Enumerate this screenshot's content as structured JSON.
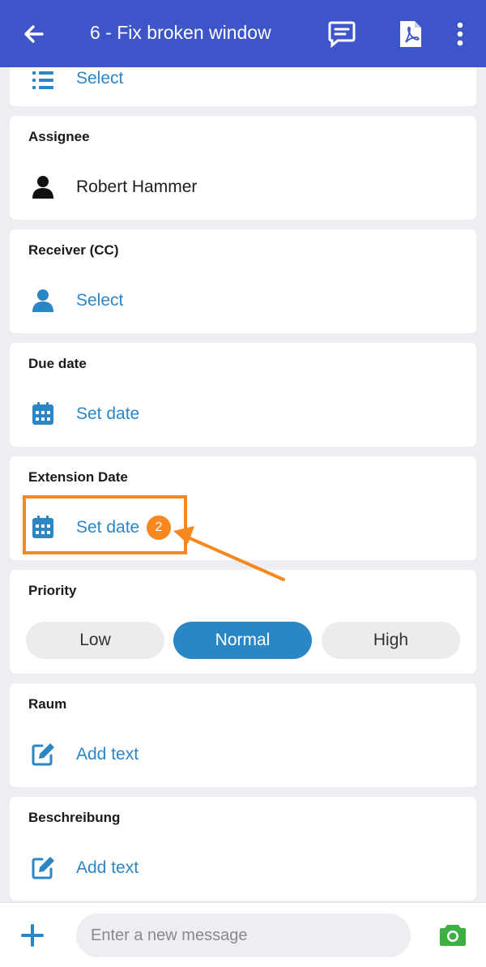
{
  "header": {
    "title": "6 - Fix broken window"
  },
  "cards": {
    "top": {
      "value": "Select"
    },
    "assignee": {
      "label": "Assignee",
      "value": "Robert Hammer"
    },
    "receiver": {
      "label": "Receiver (CC)",
      "value": "Select"
    },
    "due_date": {
      "label": "Due date",
      "value": "Set date"
    },
    "extension_date": {
      "label": "Extension Date",
      "value": "Set date"
    },
    "priority": {
      "label": "Priority",
      "options": [
        "Low",
        "Normal",
        "High"
      ],
      "selected": "Normal"
    },
    "raum": {
      "label": "Raum",
      "value": "Add text"
    },
    "beschreibung": {
      "label": "Beschreibung",
      "value": "Add text"
    }
  },
  "annotation": {
    "badge": "2",
    "color": "#f7871f"
  },
  "composer": {
    "placeholder": "Enter a new message"
  },
  "icons": [
    "back-arrow-icon",
    "comment-icon",
    "pdf-icon",
    "more-vertical-icon",
    "list-icon",
    "person-icon",
    "calendar-icon",
    "edit-icon",
    "plus-icon",
    "camera-icon"
  ],
  "colors": {
    "primary": "#3d55c8",
    "link": "#2b86c5",
    "accent": "#f7871f",
    "camera": "#3cb043"
  }
}
